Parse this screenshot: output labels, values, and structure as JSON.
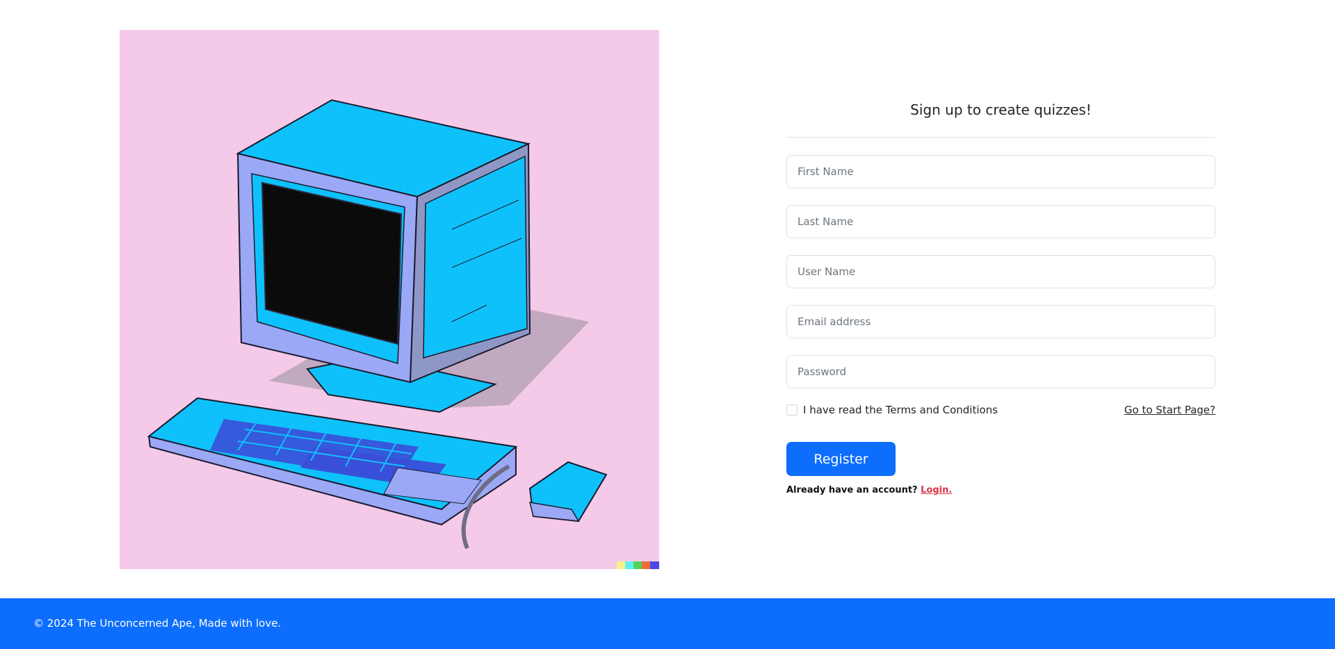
{
  "signup": {
    "title": "Sign up to create quizzes!",
    "fields": {
      "first_name": "First Name",
      "last_name": "Last Name",
      "user_name": "User Name",
      "email": "Email address",
      "password": "Password"
    },
    "terms_label": "I have read the Terms and Conditions",
    "start_link": "Go to Start Page?",
    "register_label": "Register",
    "account_prompt": "Already have an account?",
    "login_link": "Login."
  },
  "footer": {
    "text": "© 2024 The Unconcerned Ape, Made with love."
  },
  "illustration": {
    "icon": "retro-computer-illustration",
    "colors": {
      "background": "#f5c9e8",
      "body": "#0fc1fb",
      "panel": "#9aa8f6",
      "keys": "#3a4fd8",
      "screen": "#0b0b0b"
    }
  },
  "colors": {
    "primary": "#0d6efd",
    "login_link": "#dc3545"
  }
}
